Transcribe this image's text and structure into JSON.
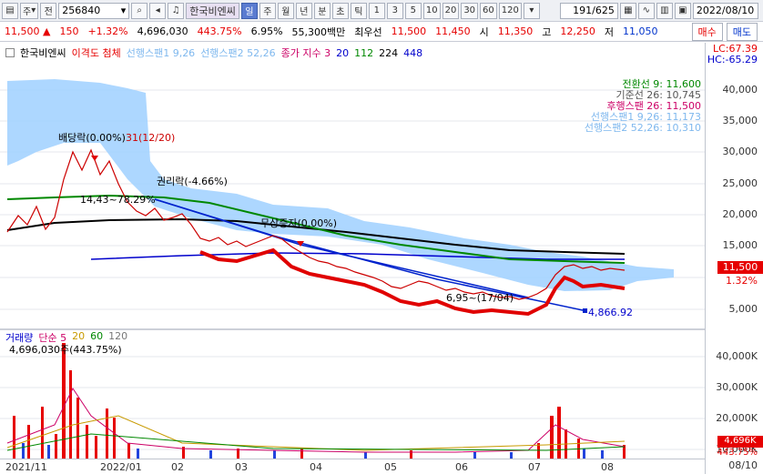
{
  "toolbar": {
    "menu_icon": "menu-icon",
    "type1": "주",
    "type2": "전",
    "code": "256840",
    "name": "한국비엔씨",
    "periods": [
      "일",
      "주",
      "월",
      "년",
      "분",
      "초",
      "틱"
    ],
    "active_period": "일",
    "minute_opts": [
      "1",
      "3",
      "5",
      "10",
      "20",
      "30",
      "60",
      "120"
    ],
    "page": "191",
    "page_total": "/625",
    "date": "2022/08/10"
  },
  "quote": {
    "price": "11,500",
    "change_arrow": "▲",
    "change": "150",
    "change_pct": "+1.32%",
    "volume": "4,696,030",
    "vol_pct": "443.75%",
    "turn": "6.95%",
    "cap": "55,300백만",
    "best_label": "최우선",
    "best_ask": "11,500",
    "best_bid": "11,450",
    "open_label": "시",
    "open": "11,350",
    "high_label": "고",
    "high": "12,250",
    "low_label": "저",
    "low": "11,050",
    "buy_btn": "매수",
    "sell_btn": "매도"
  },
  "legend": {
    "name": "한국비엔씨",
    "items": [
      {
        "label": "이격도 첨체",
        "color": "#e60000"
      },
      {
        "label": "선행스팬1 9,26",
        "color": "#8cc8ff"
      },
      {
        "label": "선행스팬2 52,26",
        "color": "#8cc8ff"
      },
      {
        "label": "종가 지수 3",
        "color": "#cc0066"
      },
      {
        "label": "20",
        "color": "#0000cc"
      },
      {
        "label": "112",
        "color": "#008800"
      },
      {
        "label": "224",
        "color": "#000000"
      },
      {
        "label": "448",
        "color": "#0000cc"
      }
    ]
  },
  "indicators": [
    {
      "label": "전환선 9: 11,600",
      "color": "#008800"
    },
    {
      "label": "기준선 26: 10,745",
      "color": "#555555"
    },
    {
      "label": "후행스팬 26: 11,500",
      "color": "#cc0066"
    },
    {
      "label": "선행스팬1 9,26: 11,173",
      "color": "#8cc8ff"
    },
    {
      "label": "선행스팬2 52,26: 10,310",
      "color": "#8cc8ff"
    }
  ],
  "annotations": {
    "a1": "배당락(0.00%)",
    "a2": "31(12/20)",
    "a3": "권리락(-4.66%)",
    "a4": "14,43~78.29%",
    "a5": "무상증자(0.00%)",
    "a6": "6,95~(17/04)",
    "a7": "4,866.92"
  },
  "price_axis": {
    "top_right1": "LC:67.39",
    "top_right2": "HC:-65.29",
    "ticks": [
      "40,000",
      "35,000",
      "30,000",
      "25,000",
      "20,000",
      "15,000",
      "10,000",
      "5,000"
    ],
    "current": "11,500",
    "current_pct": "1.32%"
  },
  "volume": {
    "legend": [
      "거래량",
      "단순 5",
      "20",
      "60",
      "120"
    ],
    "value": "4,696,030주(443.75%)",
    "ticks": [
      "40,000K",
      "30,000K",
      "20,000K",
      "10,000K"
    ],
    "current": "4,696K",
    "current_pct": "443.75%"
  },
  "x_axis": {
    "ticks": [
      "2021/11",
      "2022/01",
      "02",
      "03",
      "04",
      "05",
      "06",
      "07",
      "08"
    ],
    "right": "08/10"
  }
}
